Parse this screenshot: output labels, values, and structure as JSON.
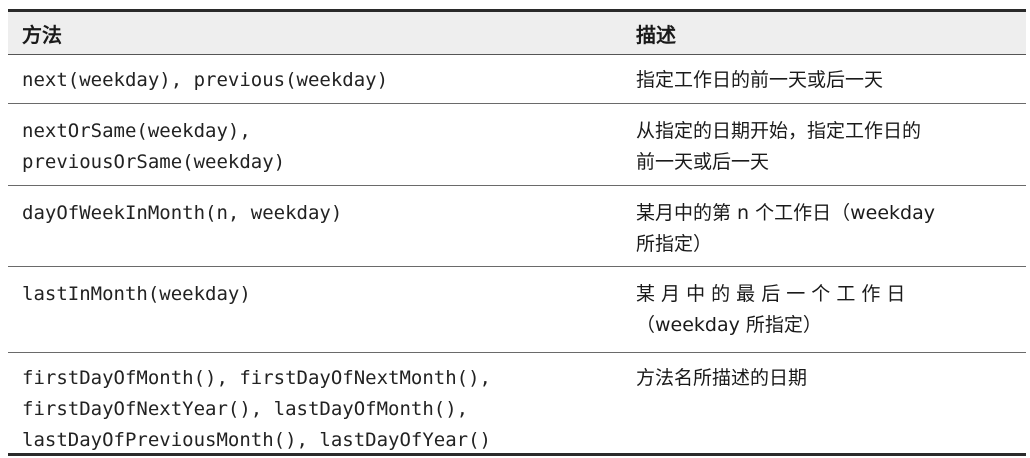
{
  "table": {
    "headers": {
      "method": "方法",
      "description": "描述"
    },
    "rows": [
      {
        "method_lines": [
          "next(weekday), previous(weekday)"
        ],
        "description_lines": [
          "指定工作日的前一天或后一天"
        ]
      },
      {
        "method_lines": [
          "nextOrSame(weekday),",
          "previousOrSame(weekday)"
        ],
        "description_lines": [
          "从指定的日期开始，指定工作日的",
          "前一天或后一天"
        ]
      },
      {
        "method_lines": [
          "dayOfWeekInMonth(n, weekday)"
        ],
        "description_lines": [
          "某月中的第 n 个工作日（weekday",
          "所指定）"
        ]
      },
      {
        "method_lines": [
          "lastInMonth(weekday)"
        ],
        "description_lines": [
          "某 月 中 的 最 后 一 个 工 作 日",
          "（weekday 所指定）"
        ]
      },
      {
        "method_lines": [
          "firstDayOfMonth(), firstDayOfNextMonth(),",
          "firstDayOfNextYear(), lastDayOfMonth(),",
          "lastDayOfPreviousMonth(), lastDayOfYear()"
        ],
        "description_lines": [
          "方法名所描述的日期"
        ]
      }
    ]
  }
}
